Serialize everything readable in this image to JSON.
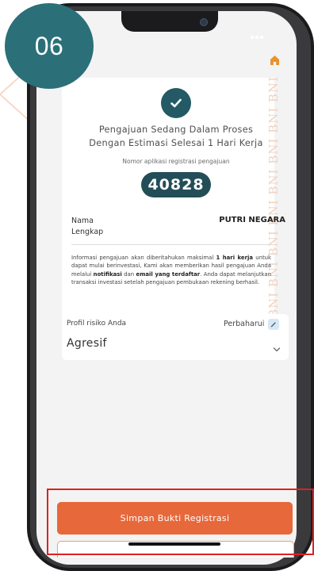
{
  "step_badge": "06",
  "watermark_text": "BNI BNI BNI BNI BNI BNI BNI BNI",
  "status": {
    "title_line1": "Pengajuan Sedang Dalam Proses",
    "title_line2": "Dengan Estimasi Selesai 1 Hari Kerja",
    "reg_label": "Nomor aplikasi registrasi pengajuan",
    "reg_number": "40828"
  },
  "profile": {
    "name_label_line1": "Nama",
    "name_label_line2": "Lengkap",
    "name_value": "PUTRI NEGARA"
  },
  "info": {
    "part1": "Informasi pengajuan akan diberitahukan maksimal ",
    "bold1": "1 hari kerja",
    "part2": " untuk dapat mulai berinvestasi, Kami akan memberikan hasil pengajuan Anda melalui ",
    "bold2": "notifikasi",
    "part3": " dan ",
    "bold3": "email yang terdaftar",
    "part4": ". Anda dapat melanjutkan transaksi investasi setelah pengajuan pembukaan rekening berhasil."
  },
  "risk": {
    "label": "Profil risiko Anda",
    "update_label": "Perbaharui",
    "value": "Agresif"
  },
  "actions": {
    "save_label": "Simpan Bukti Registrasi"
  },
  "icons": {
    "home": "home-icon",
    "check": "check-icon",
    "pencil": "pencil-icon",
    "chevron": "chevron-down-icon"
  },
  "colors": {
    "teal": "#235a65",
    "accent_orange": "#e7683a",
    "highlight_red": "#e0201f",
    "badge": "#2b7078"
  }
}
